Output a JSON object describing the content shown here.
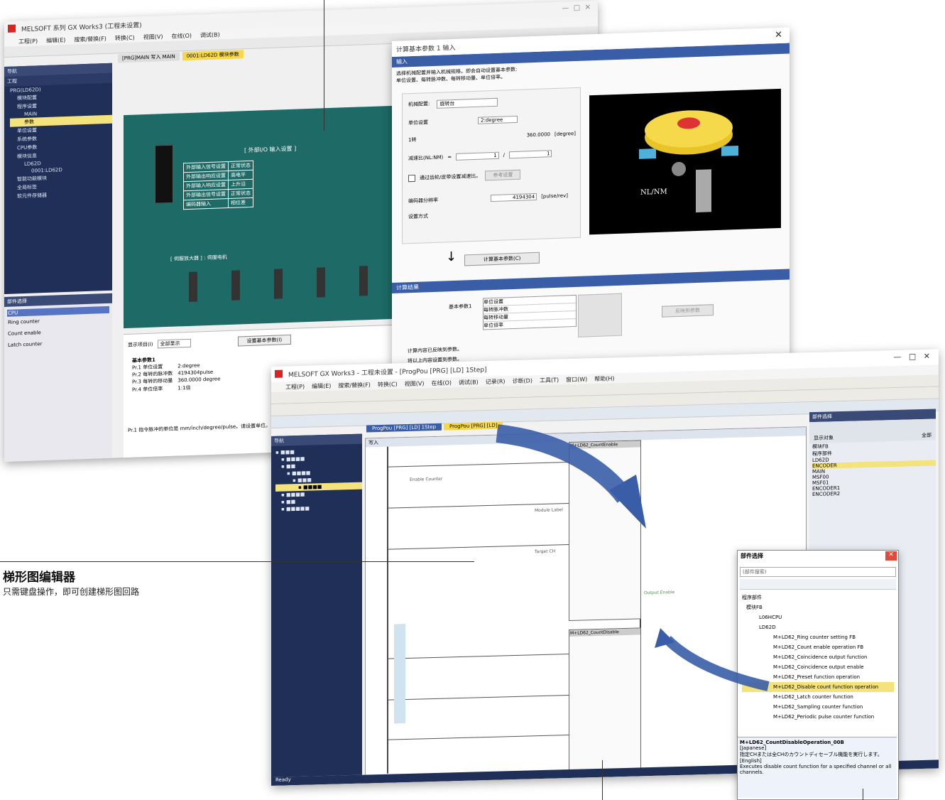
{
  "callout": {
    "title": "梯形图编辑器",
    "subtitle": "只需键盘操作，即可创建梯形图回路"
  },
  "win1": {
    "title": "MELSOFT 系列 GX Works3 (工程未设置)",
    "menu": [
      "工程(P)",
      "编辑(E)",
      "搜索/替换(F)",
      "转换(C)",
      "视图(V)",
      "在线(O)",
      "调试(B)"
    ],
    "tabs": [
      "[PRG]MAIN 写入 MAIN",
      "0001:LD62D 模块参数"
    ],
    "nav_header": "导航",
    "nav_sub": "工程",
    "tree": [
      "PRG(LD62D)",
      "模块配置",
      "程序设置",
      "MAIN",
      "参数",
      "单位设置",
      "系统参数",
      "CPU参数",
      "模块信息",
      "LD62D",
      "0001:LD62D",
      "智能功能模块",
      "全局标签",
      "软元件存储器"
    ],
    "main_header": "[ 外部I/O 输入设置 ]",
    "table_rows": [
      [
        "外部输入信号设置",
        "正常状态"
      ],
      [
        "外部输出响应设置",
        "高电平"
      ],
      [
        "外部输入响应设置",
        "上升沿"
      ],
      [
        "外部输出信号设置",
        "正常状态"
      ],
      [
        "编码器输入",
        "相位差"
      ]
    ],
    "servo_header": "[ 伺服放大器 ] : 伺服电机",
    "lower_panel": {
      "label": "显示项目(I)",
      "value": "全部显示",
      "button": "设置基本参数(I)",
      "rows": [
        [
          "基本参数1",
          "",
          ""
        ],
        [
          "Pr.1 单位设置",
          "2:degree",
          ""
        ],
        [
          "Pr.2 每转的脉冲数",
          "4194304pulse",
          ""
        ],
        [
          "Pr.3 每转的移动量",
          "360.0000 degree",
          ""
        ],
        [
          "Pr.4 单位倍率",
          "1:1倍",
          ""
        ]
      ],
      "desc": "Pr.1 指令脉冲的单位是 mm/inch/degree/pulse。请设置单位。"
    },
    "left_panel": {
      "header": "部件选择",
      "rows": [
        "CPU",
        "Ring counter",
        "Count enable",
        "Latch counter"
      ]
    }
  },
  "win2": {
    "title": "计算基本参数 1 输入",
    "section_input": "输入",
    "intro": "选择机械配置并输入机械规格，即会自动设置基本参数:\n单位设置、每转脉冲数、每转移动量、单位倍率。",
    "fields": {
      "mech_label": "机械配置:",
      "mech_value": "旋转台",
      "unit_label": "单位设置",
      "unit_value": "2:degree",
      "amount_label": "1转",
      "amount_value": "360.0000",
      "amount_unit": "[degree]",
      "reduction_label": "减速比(NL:NM)",
      "reduction_a": "1",
      "reduction_b": "1",
      "check_label": "通过齿轮/皮带设置减速比。",
      "check_button": "参考设置",
      "encoder_label": "编码器分辨率",
      "encoder_value": "4194304",
      "encoder_unit": "[pulse/rev]",
      "method_label": "设置方式"
    },
    "calc_button": "计算基本参数(C)",
    "section_result": "计算结果",
    "result_label": "基本参数1",
    "result_items": [
      "单位设置",
      "每转脉冲数",
      "每转移动量",
      "单位倍率"
    ],
    "reflect_button": "反映到参数",
    "result_msg1": "计算内容已反映到参数。",
    "result_msg2": "将以上内容设置到参数。",
    "image_label": "NL/NM"
  },
  "win3": {
    "title": "MELSOFT GX Works3 - 工程未设置 - [ProgPou [PRG] [LD] 1Step]",
    "menu": [
      "工程(P)",
      "编辑(E)",
      "搜索/替换(F)",
      "转换(C)",
      "视图(V)",
      "在线(O)",
      "调试(B)",
      "记录(R)",
      "诊断(D)",
      "工具(T)",
      "窗口(W)",
      "帮助(H)"
    ],
    "tabs": [
      "ProgPou [PRG] [LD] 1Step",
      "ProgPou [PRG] [LD]"
    ],
    "nav_header": "导航",
    "ladder_header": "写入",
    "fb_titles": [
      "M+LD62_CountEnable",
      "M+LD62_CountDisable"
    ],
    "labels": [
      "Enable Counter",
      "Module Label",
      "Target CH",
      "Output Enable"
    ],
    "parts": {
      "header": "部件选择",
      "search": "(部件搜索)",
      "tree_top": [
        "程序部件",
        "模块FB"
      ],
      "modules": [
        "LD62D",
        "L06HCPU"
      ],
      "items": [
        "M+LD62_Ring counter setting FB",
        "M+LD62_Count enable operation FB",
        "M+LD62_Coincidence output function",
        "M+LD62_Coincidence output enable",
        "M+LD62_Preset function operation",
        "M+LD62_Disable count function operation",
        "M+LD62_Latch counter function",
        "M+LD62_Sampling counter function",
        "M+LD62_Periodic pulse counter function"
      ],
      "selected_index": 5,
      "desc_title": "M+LD62_CountDisableOperation_00B",
      "desc_jp_label": "[Japanese]",
      "desc_jp": "指定CHまたは全CHのカウントディセーブル機能を実行します。",
      "desc_en_label": "[English]",
      "desc_en": "Executes disable count function for a specified channel or all channels."
    },
    "right_panel": {
      "header": "部件选择",
      "list_header": [
        "显示对象",
        "全部"
      ],
      "rows": [
        "模块FB",
        "程序部件",
        "LD62D",
        "ENCODER",
        "MAIN",
        "MSF00",
        "MSF01",
        "ENCODER1",
        "ENCODER2"
      ]
    },
    "status": "Ready"
  }
}
